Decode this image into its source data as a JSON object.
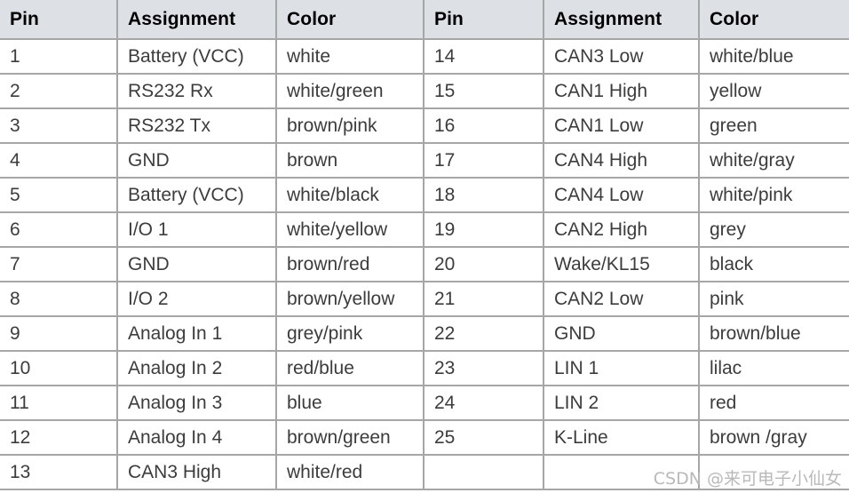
{
  "table": {
    "headers": [
      "Pin",
      "Assignment",
      "Color",
      "Pin",
      "Assignment",
      "Color"
    ],
    "rows": [
      {
        "pin_l": "1",
        "assign_l": "Battery (VCC)",
        "color_l": "white",
        "pin_r": "14",
        "assign_r": "CAN3 Low",
        "color_r": "white/blue"
      },
      {
        "pin_l": "2",
        "assign_l": "RS232 Rx",
        "color_l": "white/green",
        "pin_r": "15",
        "assign_r": "CAN1 High",
        "color_r": "yellow"
      },
      {
        "pin_l": "3",
        "assign_l": "RS232 Tx",
        "color_l": "brown/pink",
        "pin_r": "16",
        "assign_r": "CAN1 Low",
        "color_r": "green"
      },
      {
        "pin_l": "4",
        "assign_l": "GND",
        "color_l": "brown",
        "pin_r": "17",
        "assign_r": "CAN4 High",
        "color_r": "white/gray"
      },
      {
        "pin_l": "5",
        "assign_l": "Battery (VCC)",
        "color_l": "white/black",
        "pin_r": "18",
        "assign_r": "CAN4 Low",
        "color_r": "white/pink"
      },
      {
        "pin_l": "6",
        "assign_l": "I/O 1",
        "color_l": "white/yellow",
        "pin_r": "19",
        "assign_r": "CAN2 High",
        "color_r": "grey"
      },
      {
        "pin_l": "7",
        "assign_l": "GND",
        "color_l": "brown/red",
        "pin_r": "20",
        "assign_r": "Wake/KL15",
        "color_r": "black"
      },
      {
        "pin_l": "8",
        "assign_l": "I/O 2",
        "color_l": "brown/yellow",
        "pin_r": "21",
        "assign_r": "CAN2 Low",
        "color_r": "pink"
      },
      {
        "pin_l": "9",
        "assign_l": "Analog In 1",
        "color_l": "grey/pink",
        "pin_r": "22",
        "assign_r": "GND",
        "color_r": "brown/blue"
      },
      {
        "pin_l": "10",
        "assign_l": "Analog In 2",
        "color_l": "red/blue",
        "pin_r": "23",
        "assign_r": "LIN 1",
        "color_r": "lilac"
      },
      {
        "pin_l": "11",
        "assign_l": "Analog In 3",
        "color_l": "blue",
        "pin_r": "24",
        "assign_r": "LIN 2",
        "color_r": "red"
      },
      {
        "pin_l": "12",
        "assign_l": "Analog In 4",
        "color_l": "brown/green",
        "pin_r": "25",
        "assign_r": "K-Line",
        "color_r": "brown /gray"
      },
      {
        "pin_l": "13",
        "assign_l": "CAN3 High",
        "color_l": "white/red",
        "pin_r": "",
        "assign_r": "",
        "color_r": ""
      }
    ]
  },
  "watermark": {
    "text": "CSDN @来可电子小仙女"
  },
  "colors": {
    "header_bg": "#dde1e5",
    "grid_line": "#a6a6a6",
    "body_text": "#3c3c3c",
    "header_text": "#000000",
    "watermark_text": "#b9b9b9"
  }
}
